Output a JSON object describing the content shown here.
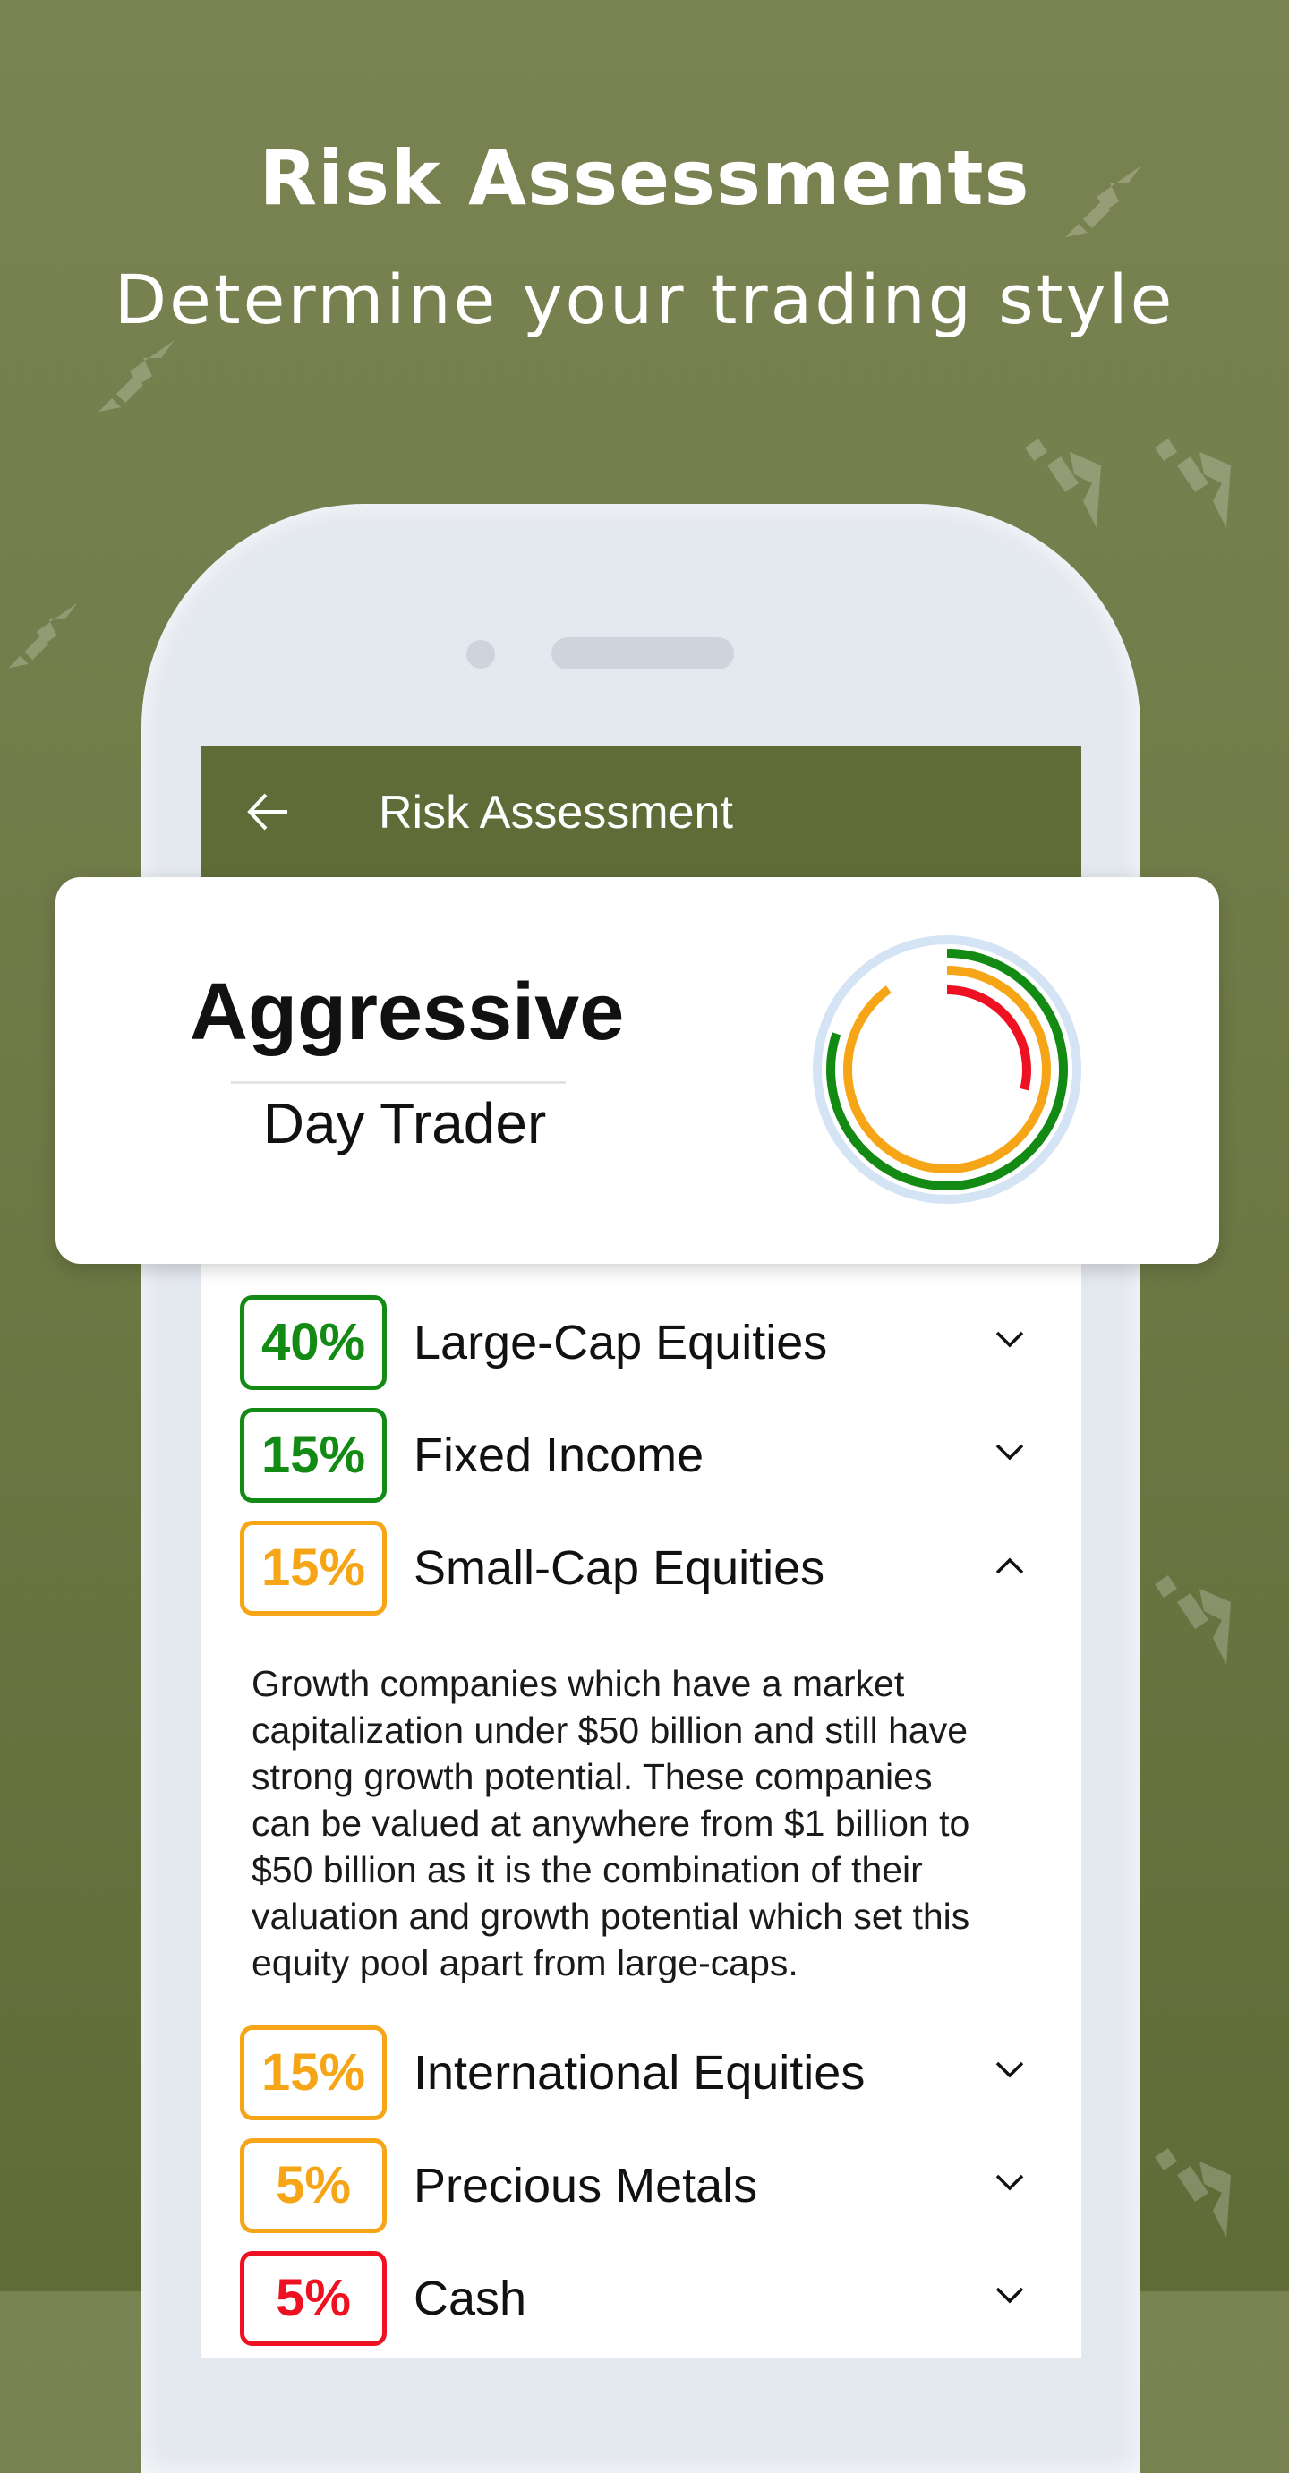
{
  "hero": {
    "title": "Risk Assessments",
    "subtitle": "Determine your trading style"
  },
  "app_bar": {
    "title": "Risk Assessment",
    "back_icon": "arrow-left-icon"
  },
  "profile": {
    "risk_level": "Aggressive",
    "style": "Day Trader"
  },
  "ring": {
    "track_color": "#d4e4f5",
    "arcs": [
      {
        "color": "#138a13",
        "fraction": 0.8
      },
      {
        "color": "#f5a516",
        "fraction": 0.9
      },
      {
        "color": "#ee1122",
        "fraction": 0.29
      }
    ]
  },
  "colors": {
    "green": "#138a13",
    "orange": "#f5a516",
    "red": "#ee1122",
    "app_bar": "#606c38"
  },
  "allocations": [
    {
      "percent": "40%",
      "label": "Large-Cap Equities",
      "color": "#138a13",
      "expanded": false
    },
    {
      "percent": "15%",
      "label": "Fixed Income",
      "color": "#138a13",
      "expanded": false
    },
    {
      "percent": "15%",
      "label": "Small-Cap Equities",
      "color": "#f5a516",
      "expanded": true
    },
    {
      "percent": "15%",
      "label": "International Equities",
      "color": "#f5a516",
      "expanded": false
    },
    {
      "percent": "5%",
      "label": "Precious Metals",
      "color": "#f5a516",
      "expanded": false
    },
    {
      "percent": "5%",
      "label": "Cash",
      "color": "#ee1122",
      "expanded": false
    }
  ],
  "expanded_description": [
    "Growth companies which have a market",
    "capitalization under $50 billion and still have",
    "strong growth potential. These companies",
    "can be valued at anywhere from $1 billion to",
    "$50 billion as it is the combination of their",
    "valuation and growth potential which set this",
    "equity pool apart from large-caps."
  ]
}
